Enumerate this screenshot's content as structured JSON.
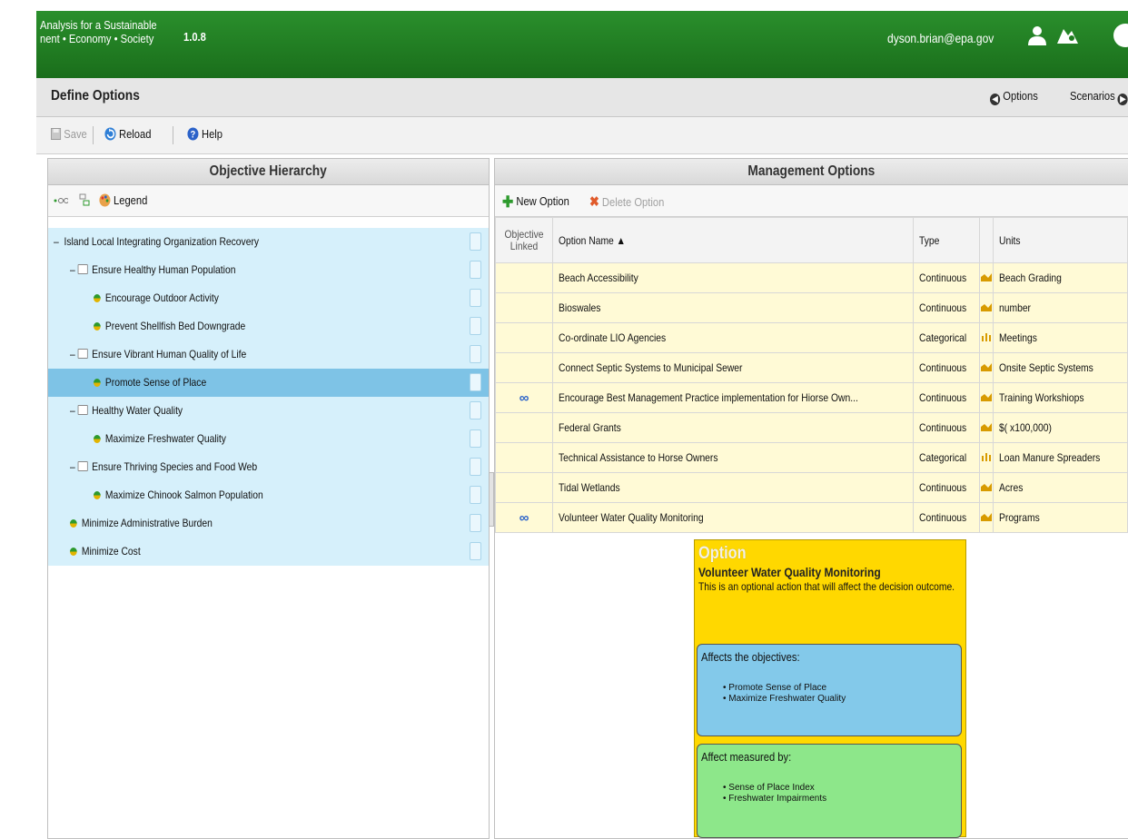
{
  "app": {
    "name_line1": "Analysis for a Sustainable",
    "name_line2": "nent • Economy • Society",
    "version": "1.0.8",
    "user_email": "dyson.brian@epa.gov"
  },
  "header": {
    "title": "Define Options",
    "nav_options": "Options",
    "nav_scenarios": "Scenarios"
  },
  "toolbar": {
    "save": "Save",
    "reload": "Reload",
    "help": "Help"
  },
  "left_panel": {
    "title": "Objective Hierarchy",
    "legend": "Legend",
    "tree": [
      {
        "label": "Island Local Integrating Organization Recovery",
        "level": 0,
        "kind": "root"
      },
      {
        "label": "Ensure Healthy Human Population",
        "level": 1,
        "kind": "folder"
      },
      {
        "label": "Encourage Outdoor Activity",
        "level": 2,
        "kind": "leaf"
      },
      {
        "label": "Prevent Shellfish Bed Downgrade",
        "level": 2,
        "kind": "leaf"
      },
      {
        "label": "Ensure Vibrant Human Quality of Life",
        "level": 1,
        "kind": "folder"
      },
      {
        "label": "Promote Sense of Place",
        "level": 2,
        "kind": "leaf",
        "selected": true
      },
      {
        "label": "Healthy Water Quality",
        "level": 1,
        "kind": "folder"
      },
      {
        "label": "Maximize Freshwater Quality",
        "level": 2,
        "kind": "leaf"
      },
      {
        "label": "Ensure Thriving Species and Food Web",
        "level": 1,
        "kind": "folder"
      },
      {
        "label": "Maximize Chinook Salmon Population",
        "level": 2,
        "kind": "leaf"
      },
      {
        "label": "Minimize Administrative Burden",
        "level": 1,
        "kind": "leaf"
      },
      {
        "label": "Minimize Cost",
        "level": 1,
        "kind": "leaf"
      }
    ]
  },
  "right_panel": {
    "title": "Management Options",
    "new_option": "New Option",
    "delete_option": "Delete Option",
    "columns": {
      "objective_linked_1": "Objective",
      "objective_linked_2": "Linked",
      "option_name": "Option Name ▲",
      "type": "Type",
      "units": "Units"
    },
    "rows": [
      {
        "linked": false,
        "name": "Beach Accessibility",
        "type": "Continuous",
        "units": "Beach Grading"
      },
      {
        "linked": false,
        "name": "Bioswales",
        "type": "Continuous",
        "units": "number"
      },
      {
        "linked": false,
        "name": "Co-ordinate LIO Agencies",
        "type": "Categorical",
        "units": "Meetings"
      },
      {
        "linked": false,
        "name": "Connect Septic Systems to Municipal Sewer",
        "type": "Continuous",
        "units": "Onsite Septic Systems"
      },
      {
        "linked": true,
        "name": "Encourage Best Management Practice implementation for Hiorse Own...",
        "type": "Continuous",
        "units": "Training Workshiops"
      },
      {
        "linked": false,
        "name": "Federal Grants",
        "type": "Continuous",
        "units": "$( x100,000)"
      },
      {
        "linked": false,
        "name": "Technical Assistance to Horse Owners",
        "type": "Categorical",
        "units": "Loan Manure Spreaders"
      },
      {
        "linked": false,
        "name": "Tidal Wetlands",
        "type": "Continuous",
        "units": "Acres"
      },
      {
        "linked": true,
        "name": "Volunteer Water Quality Monitoring",
        "type": "Continuous",
        "units": "Programs"
      }
    ]
  },
  "tooltip": {
    "heading": "Option",
    "name": "Volunteer Water Quality Monitoring",
    "description": "This is an optional action that will affect the decision outcome.",
    "objectives_title": "Affects the objectives:",
    "objectives": [
      "Promote Sense of Place",
      "Maximize Freshwater Quality"
    ],
    "measures_title": "Affect measured by:",
    "measures": [
      "Sense of Place Index",
      "Freshwater Impairments"
    ]
  },
  "colors": {
    "banner_green": "#1f7d20",
    "tree_row": "#d6f0fb",
    "tree_selected": "#7ec3e6",
    "table_row": "#fffad6",
    "tooltip_yellow": "#ffd800",
    "objectives_blue": "#83c9ea",
    "measures_green": "#8de78a"
  }
}
